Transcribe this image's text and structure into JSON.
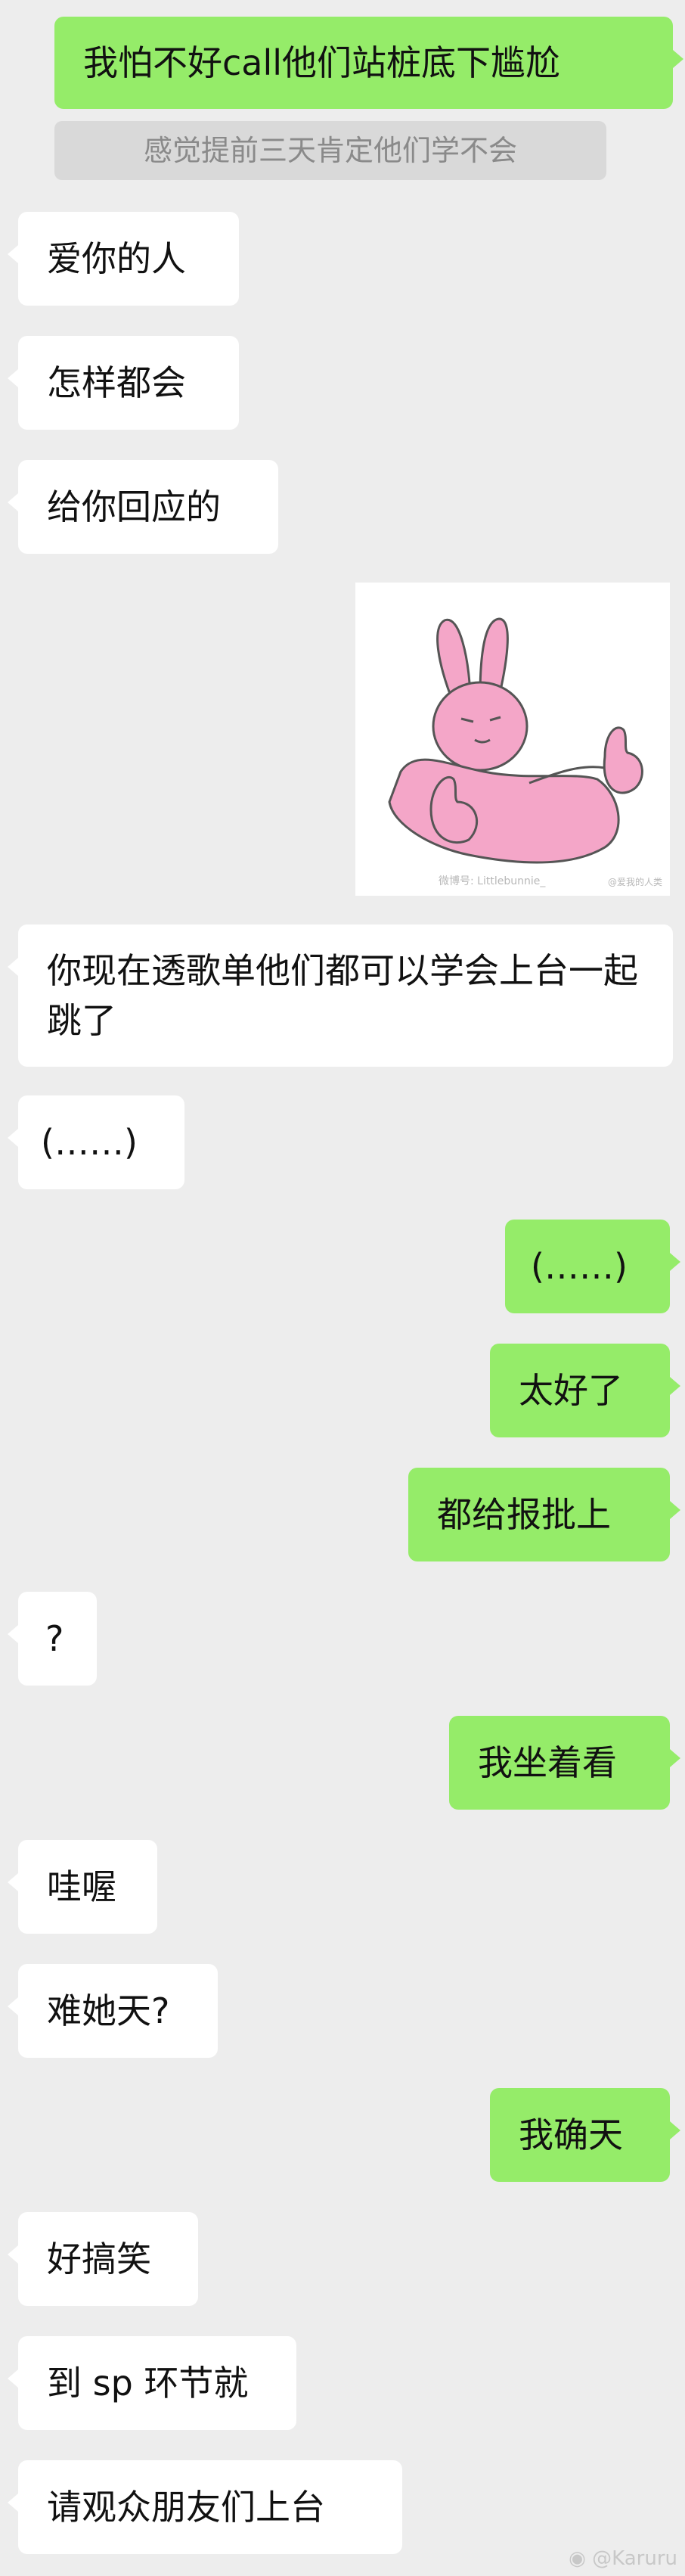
{
  "messages": [
    {
      "id": "m1",
      "text": "我怕不好call他们站桩底下尴尬"
    },
    {
      "id": "m2",
      "text": "爱你的人"
    },
    {
      "id": "m3",
      "text": "怎样都会"
    },
    {
      "id": "m4",
      "text": "给你回应的"
    },
    {
      "id": "m5",
      "text": "你现在透歌单他们都可以学会上台一起跳了"
    },
    {
      "id": "m6",
      "text": "(……)"
    },
    {
      "id": "m7",
      "text": "(……)"
    },
    {
      "id": "m8",
      "text": "太好了"
    },
    {
      "id": "m9",
      "text": "都给报批上"
    },
    {
      "id": "m10",
      "text": "?"
    },
    {
      "id": "m11",
      "text": "我坐着看"
    },
    {
      "id": "m12",
      "text": "哇喔"
    },
    {
      "id": "m13",
      "text": "难她天?"
    },
    {
      "id": "m14",
      "text": "我确天"
    },
    {
      "id": "m15",
      "text": "好搞笑"
    },
    {
      "id": "m16",
      "text": "到 sp 环节就"
    },
    {
      "id": "m17",
      "text": "请观众朋友们上台"
    }
  ],
  "quoted_reply": "感觉提前三天肯定他们学不会",
  "sticker": {
    "watermark": "微博号: Littlebunnie_",
    "watermark_small": "@爱我的人类",
    "icon": "pink-rabbit-thumbs-up-sticker"
  },
  "weibo_watermark": "@Karuru",
  "colors": {
    "background": "#ededed",
    "incoming_bubble": "#ffffff",
    "outgoing_bubble": "#95ec69",
    "text": "#111111"
  }
}
